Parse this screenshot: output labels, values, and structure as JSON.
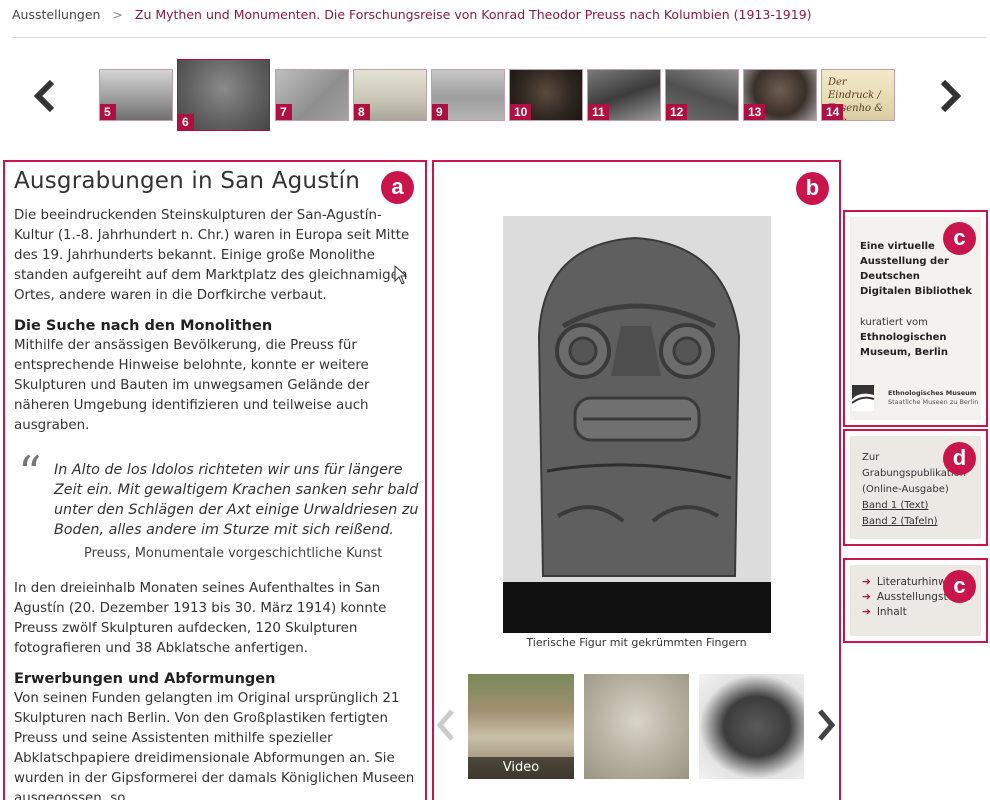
{
  "breadcrumb": {
    "home": "Ausstellungen",
    "separator": ">",
    "current": "Zu Mythen und Monumenten. Die Forschungsreise von Konrad Theodor Preuss nach Kolumbien (1913-1919)"
  },
  "thumbnail_strip": {
    "prev_icon": "chevron-left-icon",
    "next_icon": "chevron-right-icon",
    "active_index": 6,
    "thumbnails": [
      {
        "number": "5"
      },
      {
        "number": "6"
      },
      {
        "number": "7"
      },
      {
        "number": "8"
      },
      {
        "number": "9"
      },
      {
        "number": "10"
      },
      {
        "number": "11"
      },
      {
        "number": "12"
      },
      {
        "number": "13"
      },
      {
        "number": "14",
        "handwriting": "Der Eindruck / Tusenho & Lab"
      }
    ]
  },
  "markers": {
    "a": "a",
    "b": "b",
    "c": "c",
    "d": "d"
  },
  "article": {
    "title": "Ausgrabungen in San Agustín",
    "intro": "Die beeindruckenden Steinskulpturen der San-Agustín-Kultur (1.-8. Jahrhundert n. Chr.) waren in Europa seit Mitte des 19. Jahrhunderts bekannt. Einige große Monolithe standen aufgereiht auf dem Marktplatz des gleichnamigen Ortes, andere waren in die Dorfkirche verbaut.",
    "section1_heading": "Die Suche nach den Monolithen",
    "section1_text": "Mithilfe der ansässigen Bevölkerung, die Preuss für entsprechende Hinweise belohnte, konnte er weitere Skulpturen und Bauten im unwegsamen Gelände der näheren Umgebung identifizieren und teilweise auch ausgraben.",
    "quote_mark": "“",
    "quote_text": "In Alto de los Idolos richteten wir uns für längere Zeit ein. Mit gewaltigem Krachen sanken sehr bald unter den Schlägen der Axt einige Urwaldriesen zu Boden, alles andere im Sturze mit sich reißend.",
    "quote_source": "Preuss, Monumentale vorgeschichtliche Kunst",
    "paragraph2": "In den dreieinhalb Monaten seines Aufenthaltes in San Agustín (20. Dezember 1913 bis 30. März 1914) konnte Preuss zwölf Skulpturen aufdecken, 120 Skulpturen fotografieren und 38 Abklatsche anfertigen.",
    "section2_heading": "Erwerbungen und Abformungen",
    "section2_text": "Von seinen Funden gelangten im Original ursprünglich 21 Skulpturen nach Berlin. Von den Großplastiken fertigten Preuss und seine Assistenten mithilfe spezieller Abklatschpapiere dreidimensionale Abformungen an. Sie wurden in der Gipsformerei der damals Königlichen Museen ausgegossen, so"
  },
  "media": {
    "caption": "Tierische Figur mit gekrümmten Fingern",
    "gallery_prev_icon": "chevron-left-icon",
    "gallery_next_icon": "chevron-right-icon",
    "gallery": [
      {
        "label": "Video"
      },
      {
        "label": ""
      },
      {
        "label": ""
      }
    ]
  },
  "sidebar": {
    "virtual_title": "Eine virtuelle Ausstellung der Deutschen Digitalen Bibliothek",
    "curated_by": "kuratiert vom",
    "museum": "Ethnologischen Museum, Berlin",
    "logo_line1": "Ethnologisches Museum",
    "logo_line2": "Staatliche Museen zu Berlin",
    "publication_intro_line1": "Zur",
    "publication_intro_line2": "Grabungspublikation",
    "publication_intro_line3": "(Online-Ausgabe)",
    "band1": "Band 1 (Text)",
    "band2": "Band 2 (Tafeln)",
    "links": [
      {
        "label": "Literaturhinweise"
      },
      {
        "label": "Ausstellungsteam"
      },
      {
        "label": "Inhalt"
      }
    ]
  },
  "colors": {
    "accent": "#c8154c",
    "thumb_number_bg": "#b0103f",
    "breadcrumb_link": "#8b1a43"
  }
}
